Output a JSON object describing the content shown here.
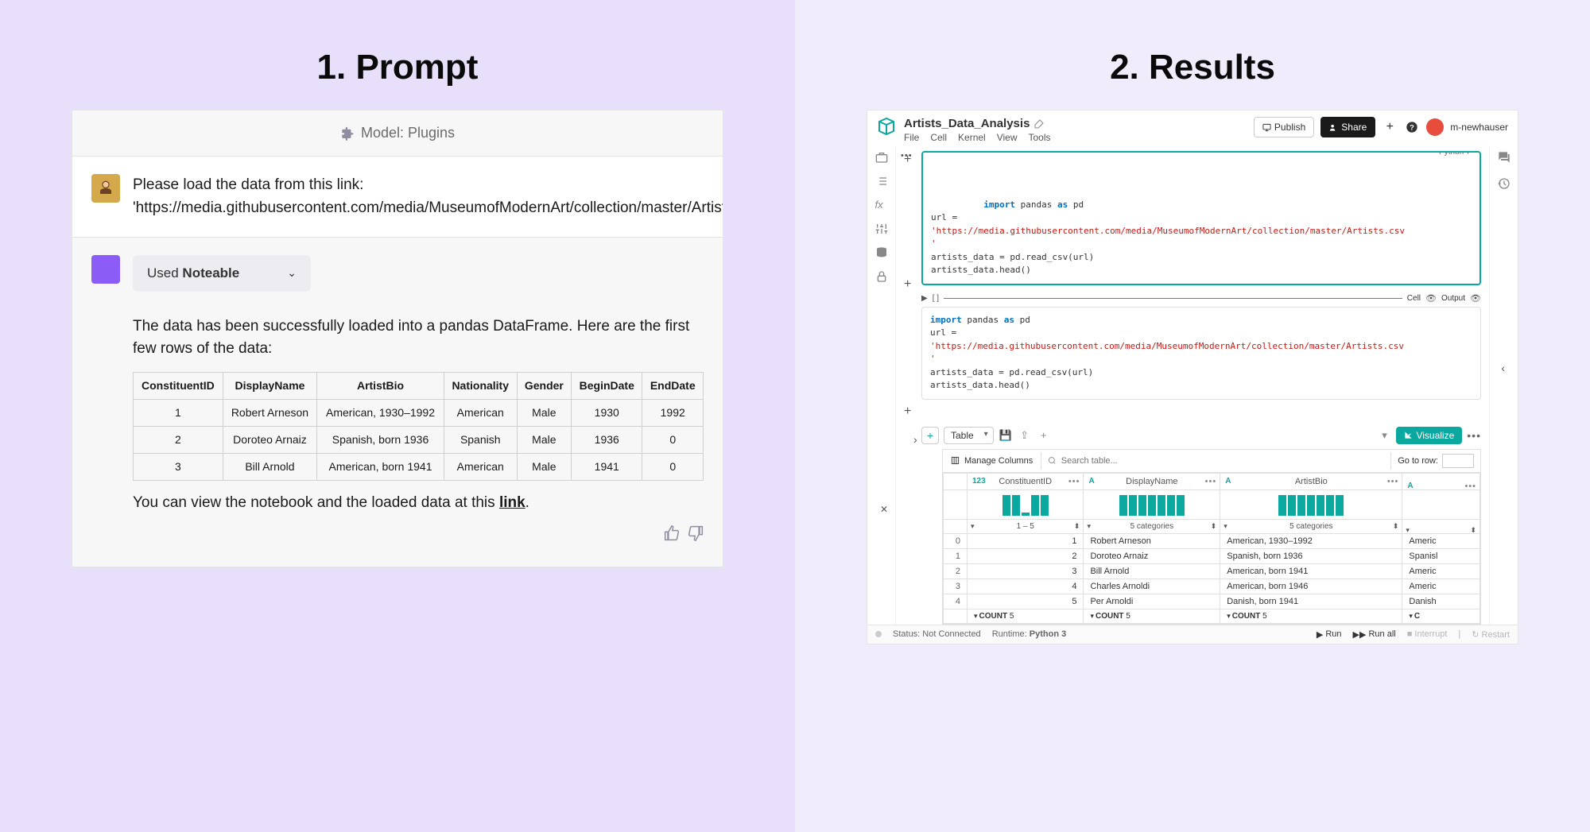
{
  "left": {
    "heading": "1. Prompt",
    "model_label": "Model: Plugins",
    "user_message": "Please load the data from this link: 'https://media.githubusercontent.com/media/MuseumofModernArt/collection/master/Artists.csv'",
    "plugin_used_prefix": "Used ",
    "plugin_used_name": "Noteable",
    "response_text_1": "The data has been successfully loaded into a pandas DataFrame. Here are the first few rows of the data:",
    "table": {
      "headers": [
        "ConstituentID",
        "DisplayName",
        "ArtistBio",
        "Nationality",
        "Gender",
        "BeginDate",
        "EndDate"
      ],
      "rows": [
        [
          "1",
          "Robert Arneson",
          "American, 1930–1992",
          "American",
          "Male",
          "1930",
          "1992"
        ],
        [
          "2",
          "Doroteo Arnaiz",
          "Spanish, born 1936",
          "Spanish",
          "Male",
          "1936",
          "0"
        ],
        [
          "3",
          "Bill Arnold",
          "American, born 1941",
          "American",
          "Male",
          "1941",
          "0"
        ]
      ]
    },
    "response_text_2_pre": "You can view the notebook and the loaded data at this ",
    "response_text_2_link": "link",
    "response_text_2_post": "."
  },
  "right": {
    "heading": "2. Results",
    "title": "Artists_Data_Analysis",
    "menus": [
      "File",
      "Cell",
      "Kernel",
      "View",
      "Tools"
    ],
    "publish": "Publish",
    "share": "Share",
    "username": "m-newhauser",
    "cell_lang": "Python",
    "code_lines": [
      {
        "t": "kw",
        "s": "import"
      },
      {
        "t": "p",
        "s": " pandas "
      },
      {
        "t": "kw2",
        "s": "as"
      },
      {
        "t": "p",
        "s": " pd\n"
      },
      {
        "t": "p",
        "s": "url =\n"
      },
      {
        "t": "str",
        "s": "'https://media.githubusercontent.com/media/MuseumofModernArt/collection/master/Artists.csv\n'"
      },
      {
        "t": "p",
        "s": "\nartists_data = pd.read_csv(url)\nartists_data.head()"
      }
    ],
    "exec_cell_label": "Cell",
    "exec_output_label": "Output",
    "table_select": "Table",
    "visualize": "Visualize",
    "manage_cols": "Manage Columns",
    "search_placeholder": "Search table...",
    "goto_label": "Go to row:",
    "out_headers": [
      {
        "type": "123",
        "label": "ConstituentID"
      },
      {
        "type": "A",
        "label": "DisplayName"
      },
      {
        "type": "A",
        "label": "ArtistBio"
      },
      {
        "type": "A",
        "label": ""
      }
    ],
    "filter_labels": [
      "1 – 5",
      "5 categories",
      "5 categories",
      ""
    ],
    "out_rows": [
      [
        "0",
        "1",
        "Robert Arneson",
        "American, 1930–1992",
        "Americ"
      ],
      [
        "1",
        "2",
        "Doroteo Arnaiz",
        "Spanish, born 1936",
        "Spanisl"
      ],
      [
        "2",
        "3",
        "Bill Arnold",
        "American, born 1941",
        "Americ"
      ],
      [
        "3",
        "4",
        "Charles Arnoldi",
        "American, born 1946",
        "Americ"
      ],
      [
        "4",
        "5",
        "Per Arnoldi",
        "Danish, born 1941",
        "Danish"
      ]
    ],
    "count_label": "COUNT",
    "count_value": "5",
    "count_partial": "C",
    "footer": {
      "status": "Status: Not Connected",
      "runtime_label": "Runtime:",
      "runtime_value": "Python 3",
      "run": "Run",
      "run_all": "Run all",
      "interrupt": "Interrupt",
      "restart": "Restart"
    }
  },
  "chart_data": {
    "type": "bar",
    "note": "Column sparkline histograms in output table header; values are approximate relative bar heights (0-1).",
    "columns": [
      {
        "name": "ConstituentID",
        "bars": [
          1,
          1,
          0.15,
          1,
          1
        ]
      },
      {
        "name": "DisplayName",
        "bars": [
          1,
          1,
          1,
          1,
          1,
          1,
          1
        ]
      },
      {
        "name": "ArtistBio",
        "bars": [
          1,
          1,
          1,
          1,
          1,
          1,
          1
        ]
      }
    ]
  }
}
